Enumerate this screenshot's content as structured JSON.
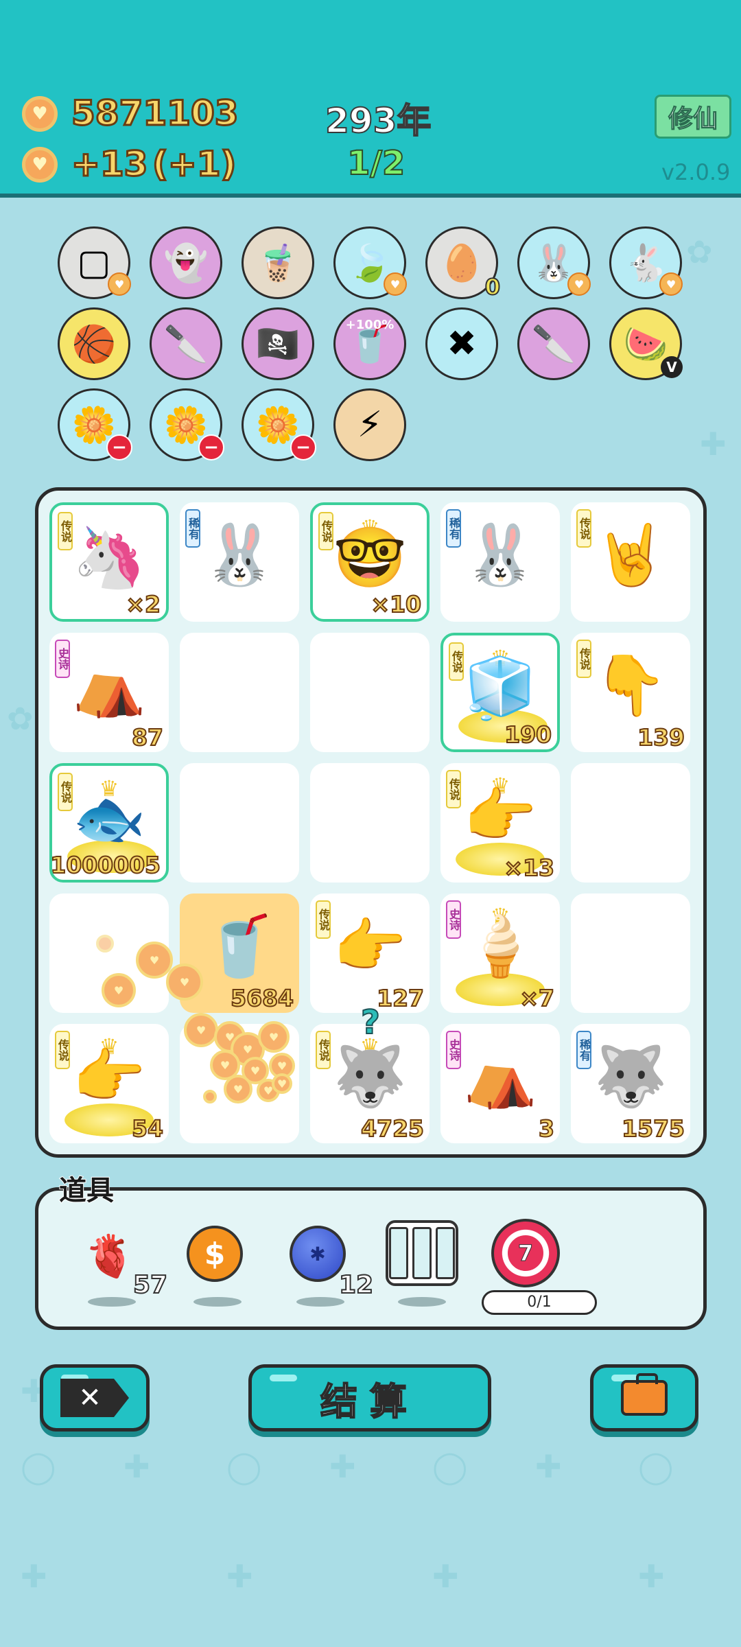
{
  "header": {
    "coins": "5871103",
    "income": "+13",
    "income_bonus": "(+1)",
    "year": "293年",
    "stage": "1/2",
    "mode_button": "修仙",
    "version": "v2.0.9"
  },
  "items_row1": [
    {
      "icon": "sugar-cubes-icon",
      "bg": "c-gray",
      "glyph": "▢",
      "badge": "heart"
    },
    {
      "icon": "ghost-icon",
      "bg": "c-purple",
      "glyph": "👻"
    },
    {
      "icon": "bubble-tea-icon",
      "bg": "c-tan",
      "glyph": "🧋"
    },
    {
      "icon": "leaf-icon",
      "bg": "c-blue",
      "glyph": "🍃",
      "badge": "heart"
    },
    {
      "icon": "egg-tray-icon",
      "bg": "c-gray",
      "glyph": "🥚",
      "badge": "zero",
      "badge_text": "0"
    },
    {
      "icon": "bunny-icon",
      "bg": "c-blue",
      "glyph": "🐰",
      "badge": "heart"
    },
    {
      "icon": "bunny-icon",
      "bg": "c-blue",
      "glyph": "🐇",
      "badge": "heart"
    }
  ],
  "items_row2": [
    {
      "icon": "basketballs-icon",
      "bg": "c-yellow",
      "glyph": "🏀"
    },
    {
      "icon": "cleaver-icon",
      "bg": "c-purple",
      "glyph": "🔪"
    },
    {
      "icon": "eyepatch-icon",
      "bg": "c-purple",
      "glyph": "🏴‍☠️"
    },
    {
      "icon": "boost-cup-icon",
      "bg": "c-purple",
      "glyph": "🥤",
      "label": "+100%"
    },
    {
      "icon": "chopsticks-icon",
      "bg": "c-blue",
      "glyph": "✖"
    },
    {
      "icon": "cleaver-icon",
      "bg": "c-purple",
      "glyph": "🔪"
    },
    {
      "icon": "fruit-basket-icon",
      "bg": "c-yellow",
      "glyph": "🍉",
      "badge": "v",
      "badge_text": "V"
    }
  ],
  "items_row3": [
    {
      "icon": "flower-pot-icon",
      "bg": "c-blue",
      "glyph": "🌼",
      "badge": "minus"
    },
    {
      "icon": "flower-pot-icon",
      "bg": "c-blue",
      "glyph": "🌼",
      "badge": "minus"
    },
    {
      "icon": "flower-pot-icon",
      "bg": "c-blue",
      "glyph": "🌼",
      "badge": "minus"
    },
    {
      "icon": "lightning-icon",
      "bg": "c-gold",
      "glyph": "⚡"
    }
  ],
  "grid": [
    {
      "tag": "传说",
      "tagtype": "leg",
      "glyph": "🦄",
      "count": "×2",
      "hl": true,
      "name": "unicorn"
    },
    {
      "tag": "稀有",
      "tagtype": "rare",
      "glyph": "🐰",
      "count": "",
      "name": "bunny"
    },
    {
      "tag": "传说",
      "tagtype": "leg",
      "glyph": "🤓",
      "count": "×10",
      "hl": true,
      "crown": true,
      "name": "crowned-face"
    },
    {
      "tag": "稀有",
      "tagtype": "rare",
      "glyph": "🐰",
      "count": "",
      "name": "bunny"
    },
    {
      "tag": "传说",
      "tagtype": "leg",
      "glyph": "🤘",
      "count": "",
      "name": "rock-hand"
    },
    {
      "tag": "史诗",
      "tagtype": "epic",
      "glyph": "⛺",
      "count": "87",
      "name": "bunny-tent"
    },
    {
      "tag": "",
      "glyph": "",
      "count": "",
      "name": "empty"
    },
    {
      "tag": "",
      "glyph": "",
      "count": "",
      "name": "empty"
    },
    {
      "tag": "传说",
      "tagtype": "leg",
      "glyph": "🧊",
      "count": "190",
      "hl": true,
      "crown": true,
      "glow": true,
      "name": "fridge"
    },
    {
      "tag": "传说",
      "tagtype": "leg",
      "glyph": "👇",
      "count": "139",
      "name": "pointing-hand"
    },
    {
      "tag": "传说",
      "tagtype": "leg",
      "glyph": "🐟",
      "count": "1000005",
      "hl": true,
      "crown": true,
      "glow": true,
      "name": "koi-fish"
    },
    {
      "tag": "",
      "glyph": "",
      "count": "",
      "name": "empty"
    },
    {
      "tag": "",
      "glyph": "",
      "count": "",
      "name": "empty"
    },
    {
      "tag": "传说",
      "tagtype": "leg",
      "glyph": "👉",
      "count": "×13",
      "crown": true,
      "glow": true,
      "name": "golden-hand"
    },
    {
      "tag": "",
      "glyph": "",
      "count": "",
      "name": "empty"
    },
    {
      "tag": "",
      "glyph": "",
      "count": "",
      "name": "coin-burst"
    },
    {
      "tag": "",
      "glyph": "🥤",
      "count": "5684",
      "orange": true,
      "name": "bubble-tea-cup"
    },
    {
      "tag": "传说",
      "tagtype": "leg",
      "glyph": "👉",
      "count": "127",
      "name": "pointing-hand"
    },
    {
      "tag": "史诗",
      "tagtype": "epic",
      "glyph": "🍦",
      "count": "×7",
      "crown": true,
      "glow": true,
      "name": "ice-cream-pair"
    },
    {
      "tag": "",
      "glyph": "",
      "count": "",
      "name": "empty"
    },
    {
      "tag": "传说",
      "tagtype": "leg",
      "glyph": "👉",
      "count": "54",
      "crown": true,
      "glow": true,
      "name": "golden-hand"
    },
    {
      "tag": "",
      "glyph": "",
      "count": "",
      "name": "coin-pile"
    },
    {
      "tag": "传说",
      "tagtype": "leg",
      "glyph": "🐺",
      "count": "4725",
      "crown": true,
      "name": "husky"
    },
    {
      "tag": "史诗",
      "tagtype": "epic",
      "glyph": "⛺",
      "count": "3",
      "name": "bunny-tent"
    },
    {
      "tag": "稀有",
      "tagtype": "rare",
      "glyph": "🐺",
      "count": "1575",
      "name": "husky"
    }
  ],
  "props": {
    "title": "道具",
    "liver_count": "57",
    "blueberry_count": "12",
    "target_number": "7",
    "target_progress": "0/1"
  },
  "buttons": {
    "settle": "结算"
  }
}
